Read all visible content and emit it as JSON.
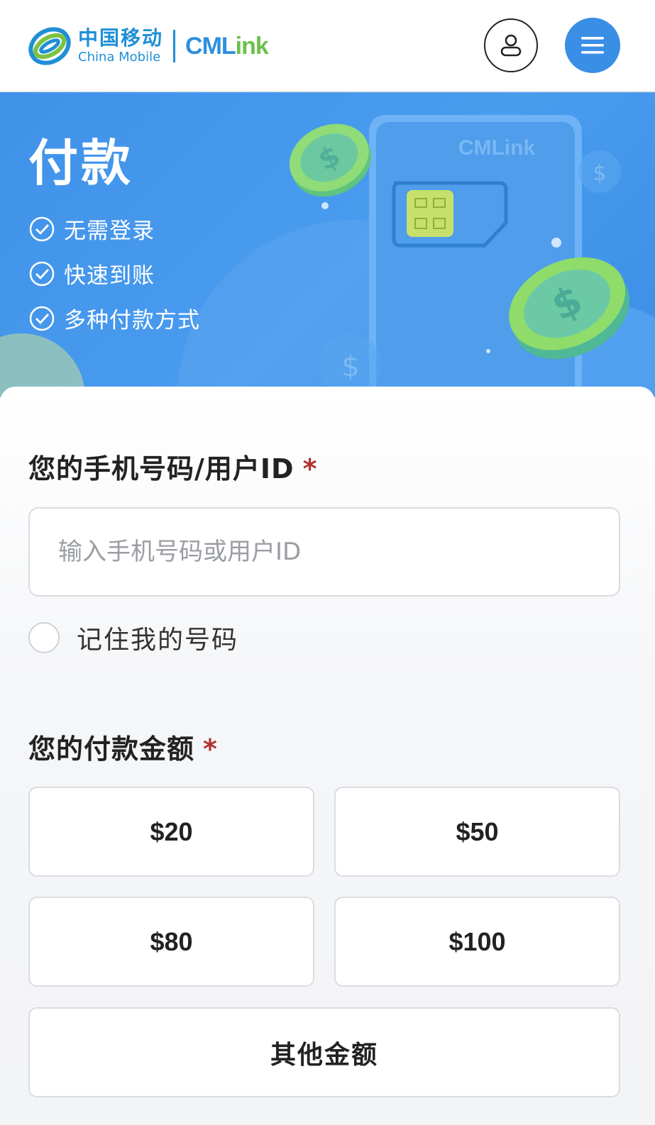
{
  "header": {
    "logo_cn": "中国移动",
    "logo_en": "China Mobile",
    "logo_cml_prefix": "CML",
    "logo_cml_suffix": "ink",
    "user_icon": "user-icon",
    "menu_icon": "menu-icon"
  },
  "banner": {
    "title": "付款",
    "features": [
      "无需登录",
      "快速到账",
      "多种付款方式"
    ],
    "sim_watermark": "CMLink"
  },
  "form": {
    "phone_label": "您的手机号码/用户ID",
    "required_mark": "*",
    "phone_placeholder": "输入手机号码或用户ID",
    "phone_value": "",
    "remember_label": "记住我的号码",
    "remember_checked": false,
    "amount_label": "您的付款金额",
    "amounts": [
      "$20",
      "$50",
      "$80",
      "$100"
    ],
    "other_amount": "其他金额"
  },
  "colors": {
    "brand_blue": "#3a8ee6",
    "brand_green": "#6cc04a",
    "required_red": "#b0312e"
  }
}
